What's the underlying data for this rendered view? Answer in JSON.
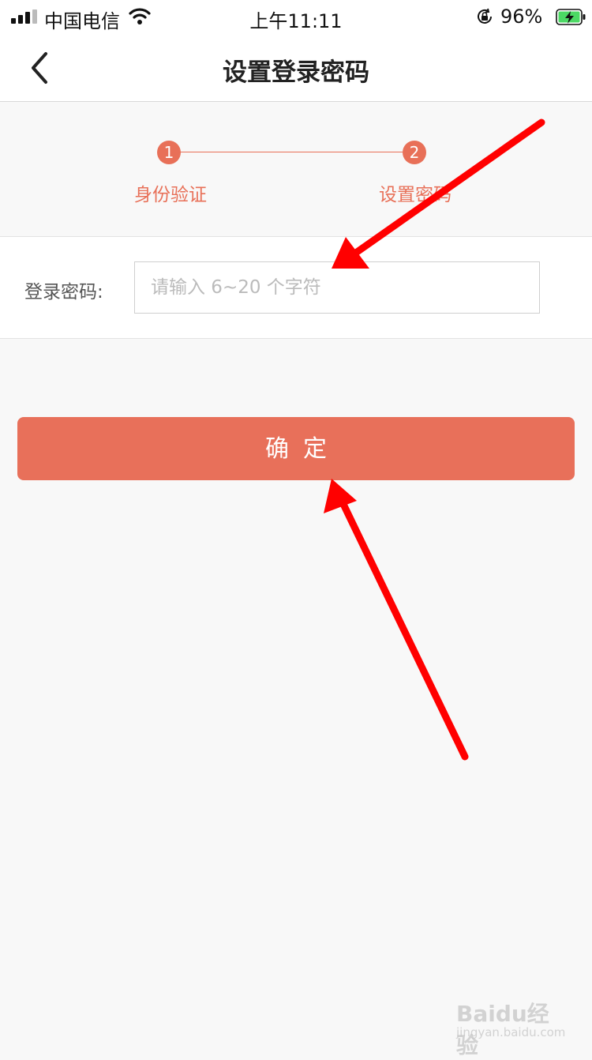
{
  "status_bar": {
    "carrier": "中国电信",
    "time": "上午11:11",
    "battery_percent": "96%",
    "icons": [
      "signal-icon",
      "wifi-icon",
      "orientation-lock-icon",
      "battery-charging-icon"
    ]
  },
  "nav": {
    "title": "设置登录密码",
    "back_icon": "chevron-left-icon"
  },
  "stepper": {
    "steps": [
      {
        "number": "1",
        "label": "身份验证"
      },
      {
        "number": "2",
        "label": "设置密码"
      }
    ],
    "accent_color": "#e87058"
  },
  "form": {
    "password_label": "登录密码:",
    "password_placeholder": "请输入 6~20 个字符",
    "password_value": ""
  },
  "confirm_label": "确定",
  "colors": {
    "primary": "#e8705a",
    "background": "#f8f8f8",
    "annotation_arrow": "#ff0000"
  },
  "watermark": {
    "main": "Baidu经验",
    "sub": "jingyan.baidu.com"
  }
}
